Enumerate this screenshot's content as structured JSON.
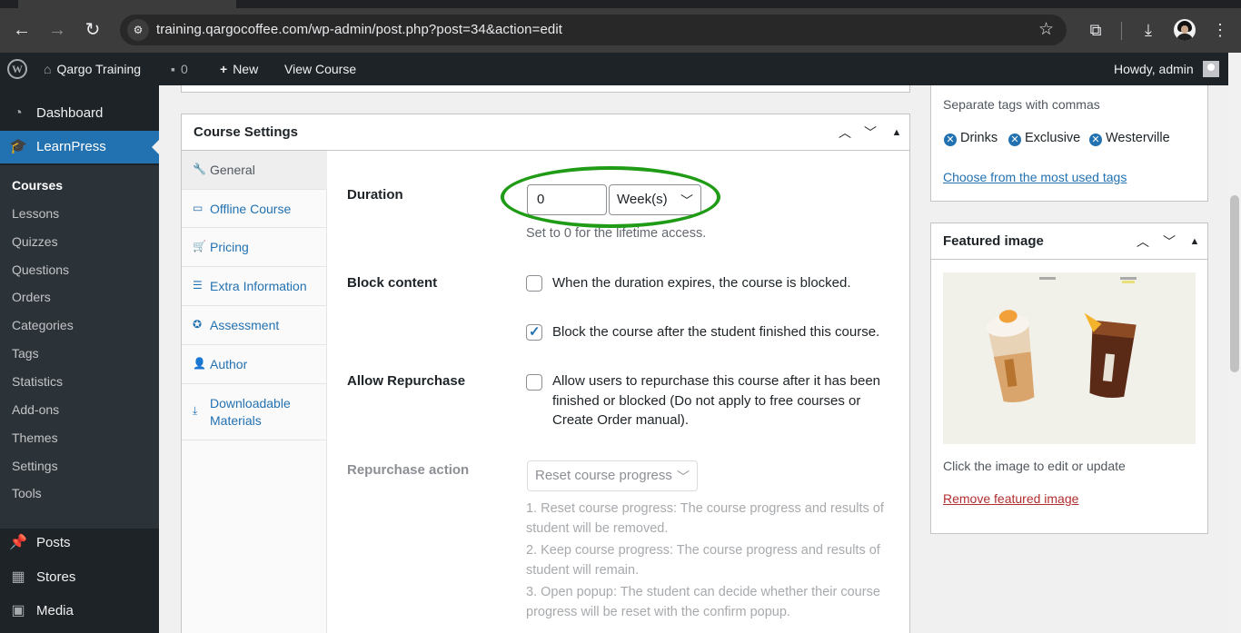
{
  "browser": {
    "url": "training.qargocoffee.com/wp-admin/post.php?post=34&action=edit",
    "icons": [
      "back-icon",
      "forward-icon",
      "reload-icon",
      "site-info-icon",
      "star-icon",
      "extensions-icon",
      "download-icon",
      "profile-avatar",
      "menu-dots-icon"
    ]
  },
  "adminbar": {
    "site_name": "Qargo Training",
    "comments_count": "0",
    "new_label": "New",
    "view_label": "View Course",
    "howdy": "Howdy, admin"
  },
  "sidebar": {
    "dashboard": "Dashboard",
    "learnpress": "LearnPress",
    "sub_items": [
      "Courses",
      "Lessons",
      "Quizzes",
      "Questions",
      "Orders",
      "Categories",
      "Tags",
      "Statistics",
      "Add-ons",
      "Themes",
      "Settings",
      "Tools"
    ],
    "posts": "Posts",
    "stores": "Stores",
    "media": "Media"
  },
  "course_settings": {
    "title": "Course Settings",
    "tabs": [
      {
        "label": "General",
        "icon": "wrench-icon"
      },
      {
        "label": "Offline Course",
        "icon": "monitor-icon"
      },
      {
        "label": "Pricing",
        "icon": "cart-icon"
      },
      {
        "label": "Extra Information",
        "icon": "list-icon"
      },
      {
        "label": "Assessment",
        "icon": "award-icon"
      },
      {
        "label": "Author",
        "icon": "user-icon"
      },
      {
        "label": "Downloadable Materials",
        "icon": "download-icon"
      }
    ],
    "duration": {
      "label": "Duration",
      "value": "0",
      "unit": "Week(s)",
      "help": "Set to 0 for the lifetime access."
    },
    "block_content": {
      "label": "Block content",
      "option1": "When the duration expires, the course is blocked.",
      "option1_checked": false,
      "option2": "Block the course after the student finished this course.",
      "option2_checked": true
    },
    "allow_repurchase": {
      "label": "Allow Repurchase",
      "text": "Allow users to repurchase this course after it has been finished or blocked (Do not apply to free courses or Create Order manual).",
      "checked": false
    },
    "repurchase_action": {
      "label": "Repurchase action",
      "value": "Reset course progress",
      "help1": "1. Reset course progress: The course progress and results of student will be removed.",
      "help2": "2. Keep course progress: The course progress and results of student will remain.",
      "help3": "3. Open popup: The student can decide whether their course progress will be reset with the confirm popup."
    }
  },
  "tags_box": {
    "help": "Separate tags with commas",
    "tags": [
      "Drinks",
      "Exclusive",
      "Westerville"
    ],
    "choose_link": "Choose from the most used tags"
  },
  "featured_image": {
    "title": "Featured image",
    "caption": "Click the image to edit or update",
    "remove": "Remove featured image"
  },
  "colors": {
    "accent": "#2271b1",
    "admin_bar": "#1d2327",
    "highlight": "#1f9b16",
    "remove_link": "#b32d2e"
  }
}
